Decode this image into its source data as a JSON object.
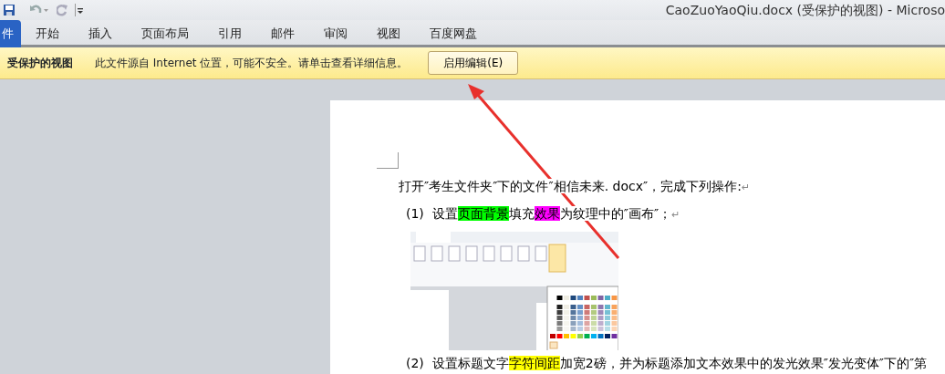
{
  "window": {
    "title": "CaoZuoYaoQiu.docx (受保护的视图)  -  Microso"
  },
  "tabs": [
    {
      "label": "件",
      "kind": "file",
      "selected": false
    },
    {
      "label": "开始",
      "kind": "tab",
      "selected": false
    },
    {
      "label": "插入",
      "kind": "tab",
      "selected": false
    },
    {
      "label": "页面布局",
      "kind": "tab",
      "selected": false
    },
    {
      "label": "引用",
      "kind": "tab",
      "selected": false
    },
    {
      "label": "邮件",
      "kind": "tab",
      "selected": false
    },
    {
      "label": "审阅",
      "kind": "tab",
      "selected": false
    },
    {
      "label": "视图",
      "kind": "tab",
      "selected": false
    },
    {
      "label": "百度网盘",
      "kind": "tab",
      "selected": false
    }
  ],
  "message_bar": {
    "title": "受保护的视图",
    "message": "此文件源自 Internet 位置，可能不安全。请单击查看详细信息。",
    "button": "启用编辑(E)"
  },
  "document": {
    "paragraphs": [
      {
        "kind": "text",
        "segments": [
          {
            "text": "打开″考生文件夹″下的文件″相信未来. docx″，完成下列操作:"
          }
        ],
        "end_mark": "↵"
      },
      {
        "kind": "text",
        "number": "(1)",
        "segments": [
          {
            "text": "设置"
          },
          {
            "text": "页面背景",
            "color": "#00ff00"
          },
          {
            "text": "填充"
          },
          {
            "text": "效果",
            "color": "#ff00ff"
          },
          {
            "text": "为纹理中的″画布″；"
          }
        ],
        "end_mark": "↵"
      },
      {
        "kind": "image"
      },
      {
        "kind": "text",
        "number": "(2)",
        "segments": [
          {
            "text": "设置标题文字"
          },
          {
            "text": "字符间距",
            "color": "#ffff00"
          },
          {
            "text": "加宽2磅，并为标题添加文本效果中的发光效果″发光变体″下的″第"
          }
        ]
      }
    ]
  }
}
